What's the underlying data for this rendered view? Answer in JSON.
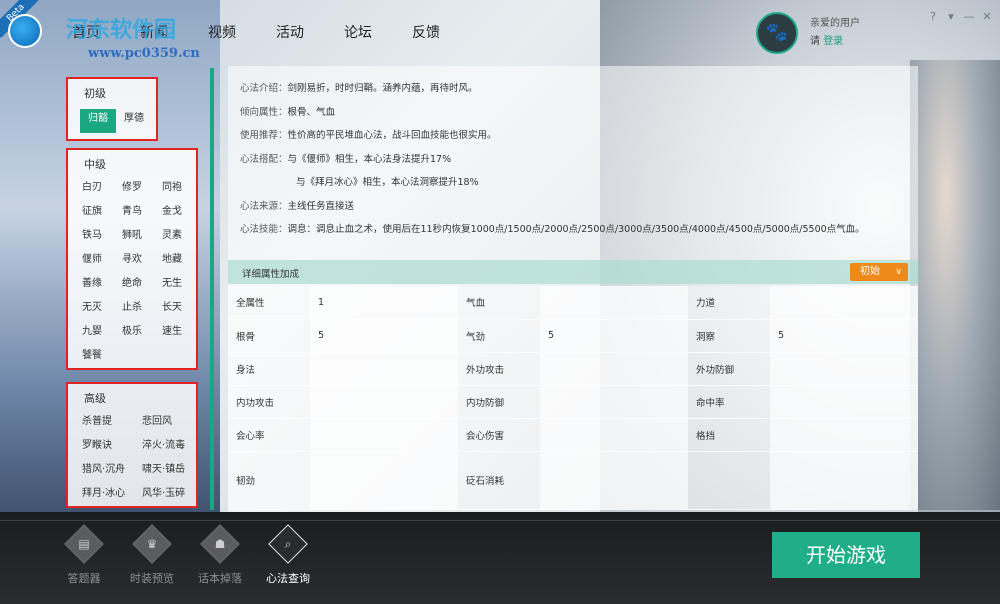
{
  "app": {
    "beta_badge": "Beta",
    "watermark": "河东软件园",
    "watermark_url": "www.pc0359.cn"
  },
  "nav": {
    "items": [
      {
        "label": "首页"
      },
      {
        "label": "新闻"
      },
      {
        "label": "视频"
      },
      {
        "label": "活动"
      },
      {
        "label": "论坛"
      },
      {
        "label": "反馈"
      }
    ]
  },
  "user": {
    "name": "亲爱的用户",
    "login_prefix": "请",
    "login_link": "登录"
  },
  "window_controls": {
    "help": "?",
    "menu": "▾",
    "minimize": "—",
    "close": "✕"
  },
  "tiers": {
    "basic": {
      "title": "初级",
      "items": [
        "归豁",
        "厚德"
      ],
      "active_index": 0
    },
    "middle": {
      "title": "中级",
      "items": [
        "白刃",
        "修罗",
        "同袍",
        "征旗",
        "青鸟",
        "金戈",
        "铁马",
        "狮吼",
        "灵素",
        "偃师",
        "寻欢",
        "地藏",
        "善缘",
        "绝命",
        "无生",
        "无灭",
        "止杀",
        "长天",
        "九婴",
        "极乐",
        "速生",
        "饕餮"
      ]
    },
    "advanced": {
      "title": "高级",
      "items": [
        "杀普提",
        "悲回风",
        "罗睺诀",
        "淬火·流毒",
        "猎风·沉舟",
        "啸天·镇岳",
        "拜月·冰心",
        "风华·玉碎"
      ]
    }
  },
  "detail": {
    "intro_label": "心法介绍：",
    "intro": "剑刚易折，时时归鞘。涵养内蕴，再待时风。",
    "attr_label": "倾向属性：",
    "attr": "根骨、气血",
    "use_label": "使用推荐：",
    "use": "性价高的平民堆血心法，战斗回血技能也很实用。",
    "match_label": "心法搭配：",
    "match1": "与《偃师》相生，本心法身法提升17%",
    "match2": "与《拜月冰心》相生，本心法洞察提升18%",
    "source_label": "心法来源：",
    "source": "主线任务直接送",
    "skill_label": "心法技能：",
    "skill": "调息：调息止血之术，使用后在11秒内恢复1000点/1500点/2000点/2500点/3000点/3500点/4000点/4500点/5000点/5500点气血。"
  },
  "attributes": {
    "header": "详细属性加成",
    "level_selected": "初始",
    "rows": [
      [
        {
          "k": "全属性",
          "v": "1"
        },
        {
          "k": "气血",
          "v": ""
        },
        {
          "k": "力道",
          "v": ""
        }
      ],
      [
        {
          "k": "根骨",
          "v": "5"
        },
        {
          "k": "气劲",
          "v": "5"
        },
        {
          "k": "洞察",
          "v": "5"
        }
      ],
      [
        {
          "k": "身法",
          "v": ""
        },
        {
          "k": "外功攻击",
          "v": ""
        },
        {
          "k": "外功防御",
          "v": ""
        }
      ],
      [
        {
          "k": "内功攻击",
          "v": ""
        },
        {
          "k": "内功防御",
          "v": ""
        },
        {
          "k": "命中率",
          "v": ""
        }
      ],
      [
        {
          "k": "会心率",
          "v": ""
        },
        {
          "k": "会心伤害",
          "v": ""
        },
        {
          "k": "格挡",
          "v": ""
        }
      ],
      [
        {
          "k": "韧劲",
          "v": ""
        },
        {
          "k": "砭石消耗",
          "v": ""
        },
        {
          "k": "",
          "v": ""
        }
      ]
    ]
  },
  "bottom": {
    "tools": [
      {
        "label": "答题器",
        "icon": "quiz-icon",
        "glyph": "▤"
      },
      {
        "label": "时装预览",
        "icon": "costume-icon",
        "glyph": "♛"
      },
      {
        "label": "话本掉落",
        "icon": "drop-icon",
        "glyph": "☗"
      },
      {
        "label": "心法查询",
        "icon": "search-icon",
        "glyph": "⌕"
      }
    ],
    "active_tool": 3,
    "start_label": "开始游戏"
  }
}
